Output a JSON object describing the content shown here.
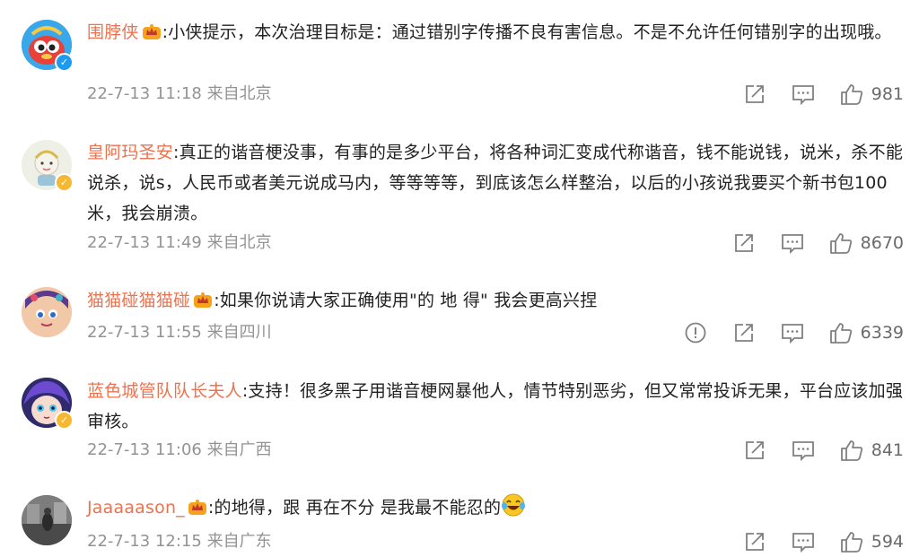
{
  "comments": [
    {
      "username": "围脖侠",
      "text": ":小侠提示，本次治理目标是：通过错别字传播不良有害信息。不是不允许任何错别字的出现哦。",
      "meta": "22-7-13 11:18 来自北京",
      "likes": "981",
      "badge": "blue-v",
      "vip": true
    },
    {
      "username": "皇阿玛圣安",
      "text": ":真正的谐音梗没事，有事的是多少平台，将各种词汇变成代称谐音，钱不能说钱，说米，杀不能说杀，说s，人民币或者美元说成马内，等等等等，到底该怎么样整治，以后的小孩说我要买个新书包100米，我会崩溃。",
      "meta": "22-7-13 11:49 来自北京",
      "likes": "8670",
      "badge": "gold-v",
      "vip": false
    },
    {
      "username": "猫猫碰猫猫碰",
      "text": ":如果你说请大家正确使用\"的  地  得\" 我会更高兴捏",
      "meta": "22-7-13 11:55 来自四川",
      "likes": "6339",
      "badge": "",
      "vip": true,
      "has_report": true
    },
    {
      "username": "蓝色城管队队长夫人",
      "text": ":支持！很多黑子用谐音梗网暴他人，情节特别恶劣，但又常常投诉无果，平台应该加强审核。",
      "meta": "22-7-13 11:06 来自广西",
      "likes": "841",
      "badge": "gold-v",
      "vip": false
    },
    {
      "username": "Jaaaaason_",
      "text": ":的地得，跟 再在不分 是我最不能忍的",
      "meta": "22-7-13 12:15 来自广东",
      "likes": "594",
      "badge": "",
      "vip": true,
      "emoji": "laugh-cry-emoji"
    }
  ],
  "colors": {
    "username": "#eb7350",
    "body": "#222222",
    "meta": "#939393",
    "icon": "#808080",
    "gold_badge": "#f7b731",
    "blue_badge": "#1d9bf0"
  },
  "icons": {
    "share": "share-icon",
    "comment": "comment-icon",
    "like": "thumbs-up-icon",
    "report": "report-icon",
    "vip": "vip-crown-icon"
  }
}
